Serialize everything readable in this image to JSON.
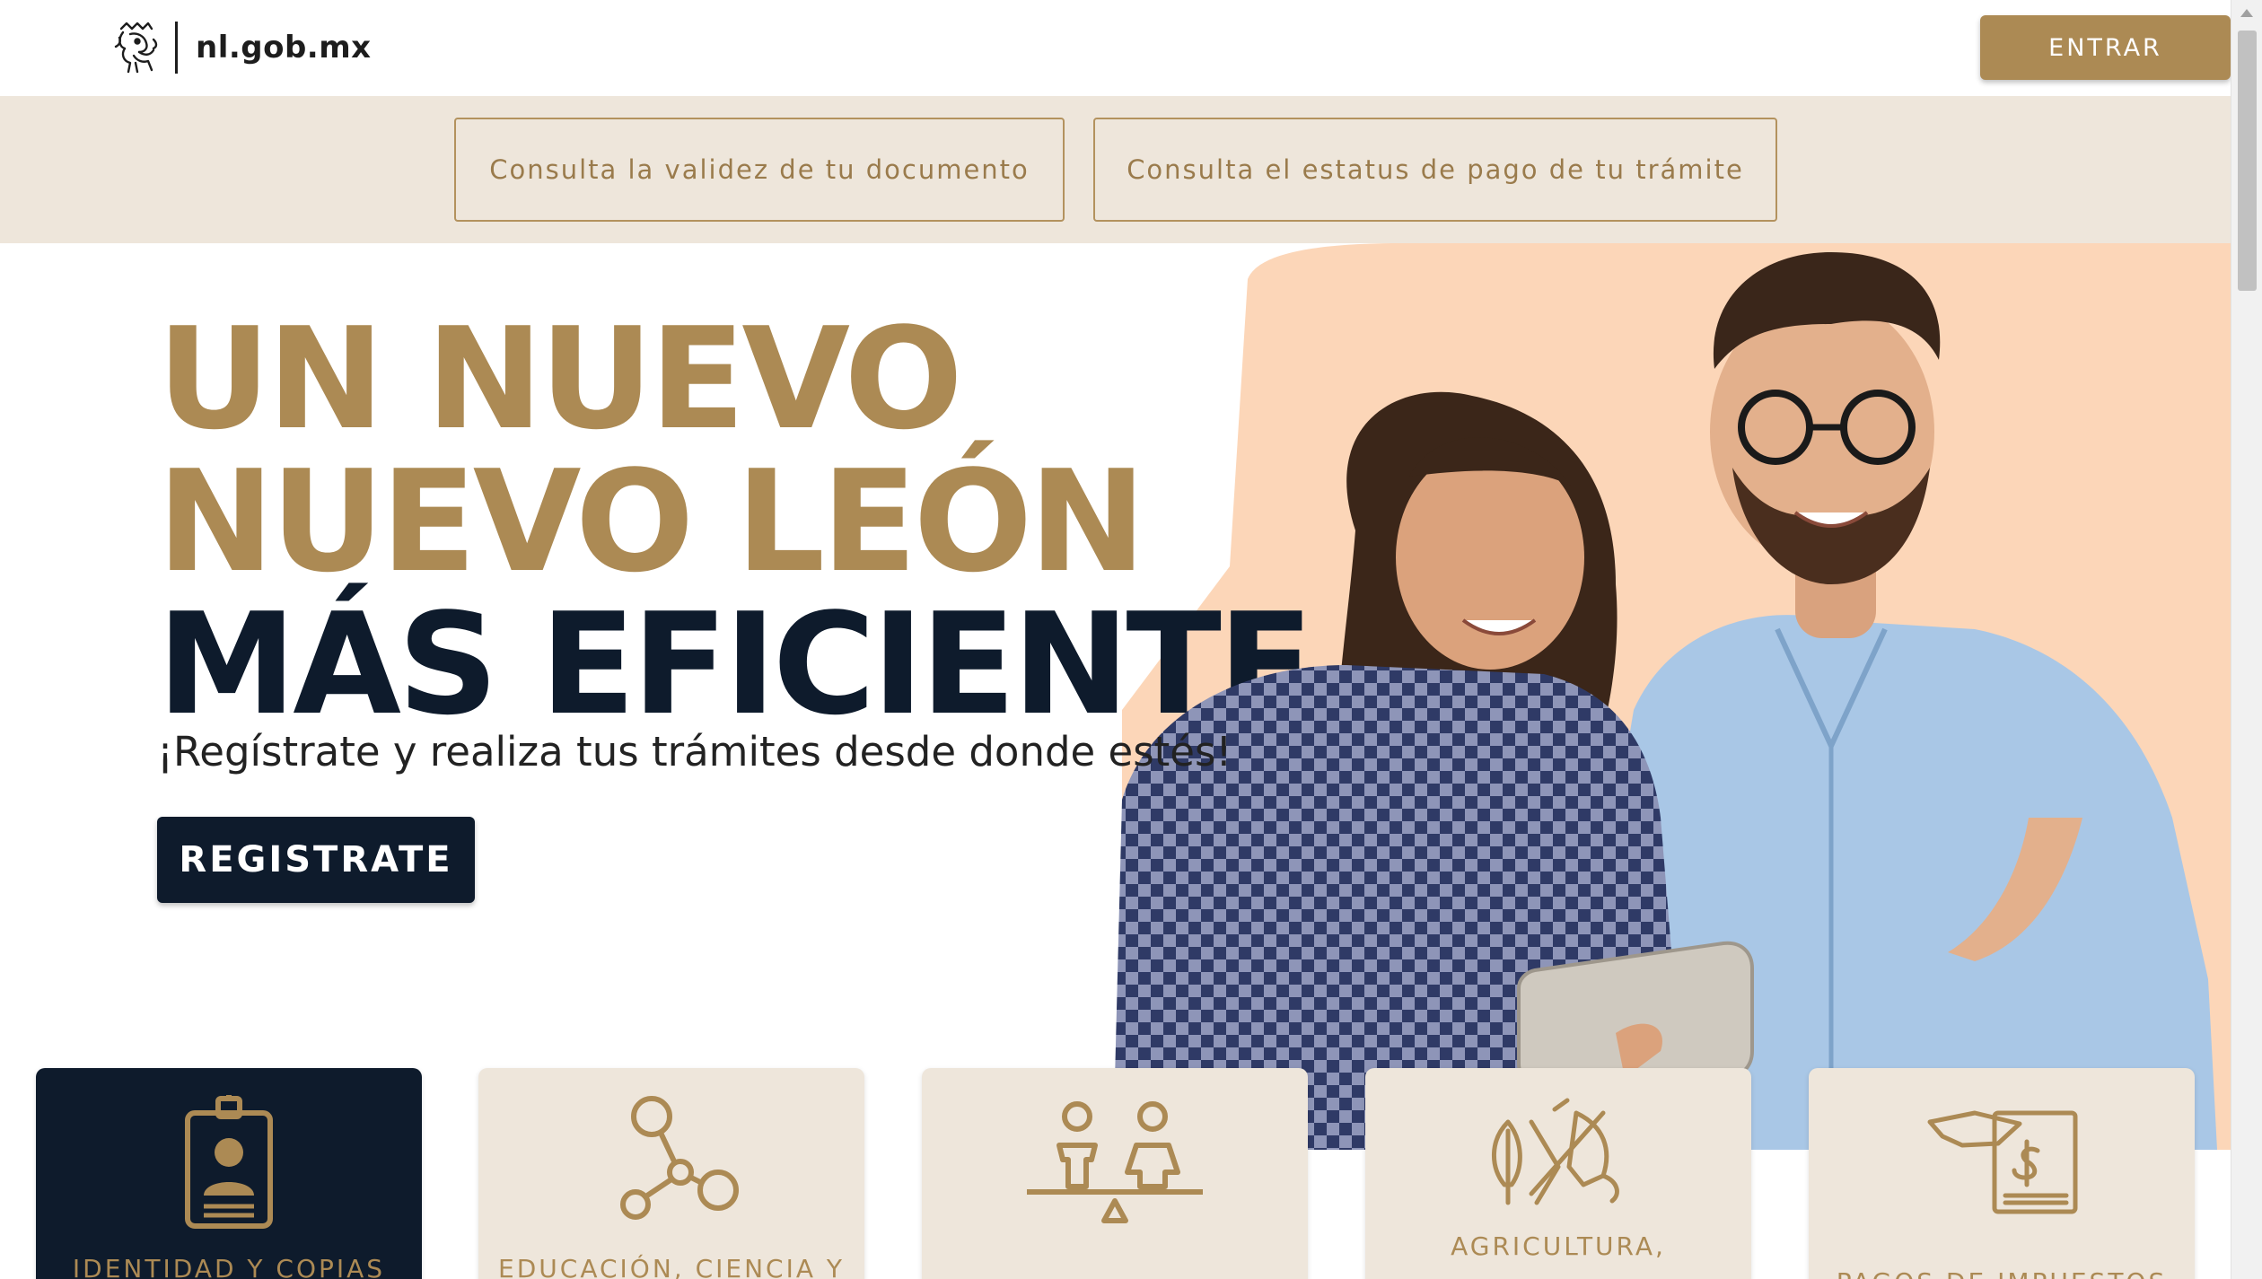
{
  "header": {
    "logo_text": "nl.gob.mx",
    "logo_icon": "lion-crest-icon",
    "login_label": "ENTRAR"
  },
  "quick_links": {
    "validate_document": "Consulta la validez de tu documento",
    "payment_status": "Consulta el estatus de pago de tu trámite"
  },
  "hero": {
    "headline_line1": "UN NUEVO",
    "headline_line2": "NUEVO LEÓN",
    "headline_line3": "MÁS EFICIENTE",
    "subtitle": "¡Regístrate y realiza tus trámites desde donde estés!",
    "register_label": "REGISTRATE",
    "image": "two-people-looking-at-tablet"
  },
  "categories": [
    {
      "label": "IDENTIDAD Y COPIAS",
      "icon": "id-badge-icon",
      "active": true
    },
    {
      "label": "EDUCACIÓN, CIENCIA Y",
      "icon": "network-nodes-icon",
      "active": false
    },
    {
      "label": "",
      "icon": "equality-balance-icon",
      "active": false
    },
    {
      "label": "AGRICULTURA,",
      "icon": "plants-animal-icon",
      "active": false
    },
    {
      "label": "PAGOS DE IMPUESTOS",
      "icon": "tax-payment-icon",
      "active": false
    }
  ],
  "colors": {
    "gold": "#ac8a54",
    "navy": "#0e1b2c",
    "cream": "#eee6db",
    "peach": "#fcd6b8"
  }
}
